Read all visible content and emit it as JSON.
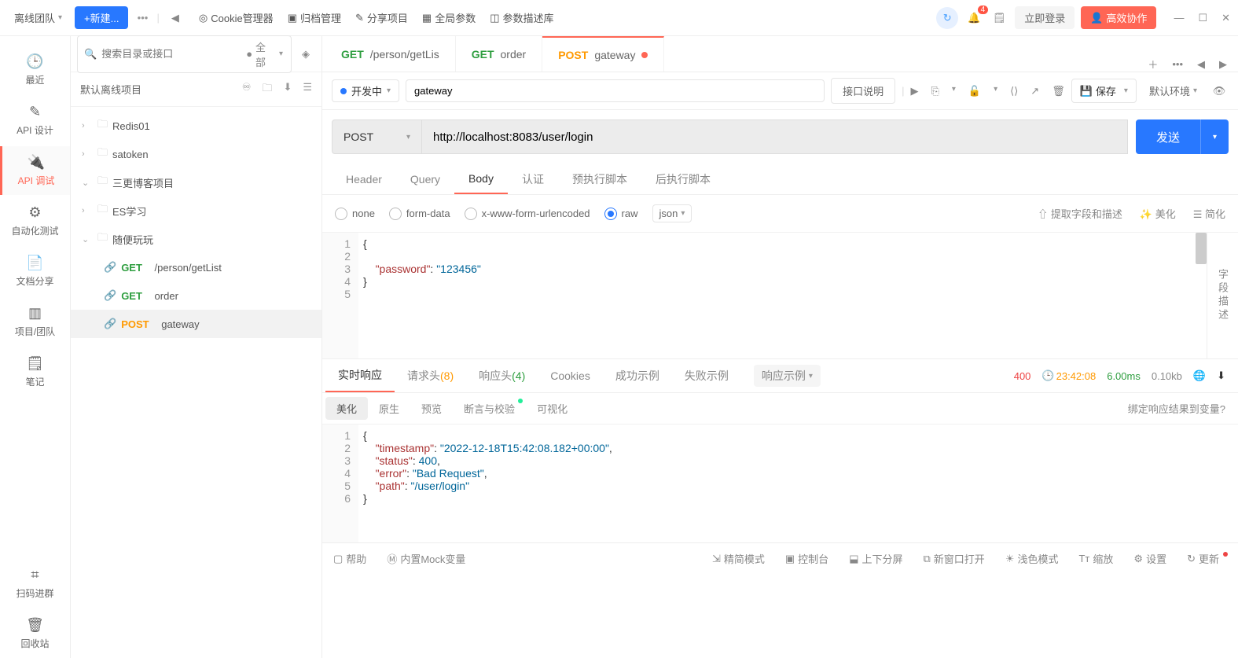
{
  "topbar": {
    "team": "离线团队",
    "newBtn": "+新建...",
    "links": [
      "Cookie管理器",
      "归档管理",
      "分享项目",
      "全局参数",
      "参数描述库"
    ],
    "login": "立即登录",
    "collab": "高效协作",
    "notifCount": "4"
  },
  "rail": {
    "recent": "最近",
    "design": "API 设计",
    "debug": "API 调试",
    "auto": "自动化测试",
    "share": "文档分享",
    "team": "项目/团队",
    "note": "笔记",
    "scan": "扫码进群",
    "recycle": "回收站"
  },
  "project": {
    "searchPlaceholder": "搜索目录或接口",
    "filterAll": "全部",
    "name": "默认离线项目",
    "folders": {
      "f1": "Redis01",
      "f2": "satoken",
      "f3": "三更博客项目",
      "f4": "ES学习",
      "f5": "随便玩玩"
    },
    "apis": {
      "a1m": "GET",
      "a1p": "/person/getList",
      "a2m": "GET",
      "a2n": "order",
      "a3m": "POST",
      "a3n": "gateway"
    }
  },
  "tabs": {
    "t1m": "GET",
    "t1l": "/person/getLis",
    "t2m": "GET",
    "t2l": "order",
    "t3m": "POST",
    "t3l": "gateway"
  },
  "req": {
    "status": "开发中",
    "name": "gateway",
    "descBtn": "接口说明",
    "saveBtn": "保存",
    "env": "默认环境",
    "method": "POST",
    "url": "http://localhost:8083/user/login",
    "sendBtn": "发送"
  },
  "reqTabs": [
    "Header",
    "Query",
    "Body",
    "认证",
    "预执行脚本",
    "后执行脚本"
  ],
  "bodyType": {
    "none": "none",
    "form": "form-data",
    "xform": "x-www-form-urlencoded",
    "raw": "raw",
    "json": "json",
    "extract": "提取字段和描述",
    "beauty": "美化",
    "simplify": "简化",
    "sidepanel": "字段描述"
  },
  "bodyCode": {
    "l1": "{",
    "l3k": "\"password\"",
    "l3c": ": ",
    "l3v": "\"123456\"",
    "l4": "}"
  },
  "respTabs": {
    "rt": "实时响应",
    "reqh": "请求头",
    "reqhc": "(8)",
    "resh": "响应头",
    "reshc": "(4)",
    "ck": "Cookies",
    "ok": "成功示例",
    "fail": "失败示例",
    "ex": "响应示例",
    "status": "400",
    "time": "23:42:08",
    "dur": "6.00ms",
    "size": "0.10kb"
  },
  "fmtTabs": {
    "beauty": "美化",
    "raw": "原生",
    "preview": "预览",
    "assert": "断言与校验",
    "visual": "可视化",
    "bind": "绑定响应结果到变量?"
  },
  "respCode": {
    "l1": "{",
    "l2k": "\"timestamp\"",
    "l2v": "\"2022-12-18T15:42:08.182+00:00\"",
    "l3k": "\"status\"",
    "l3v": "400",
    "l4k": "\"error\"",
    "l4v": "\"Bad Request\"",
    "l5k": "\"path\"",
    "l5v": "\"/user/login\"",
    "l6": "}"
  },
  "footer": {
    "help": "帮助",
    "mock": "内置Mock变量",
    "lite": "精简模式",
    "console": "控制台",
    "split": "上下分屏",
    "newwin": "新窗口打开",
    "theme": "浅色模式",
    "zoom": "缩放",
    "settings": "设置",
    "update": "更新"
  }
}
